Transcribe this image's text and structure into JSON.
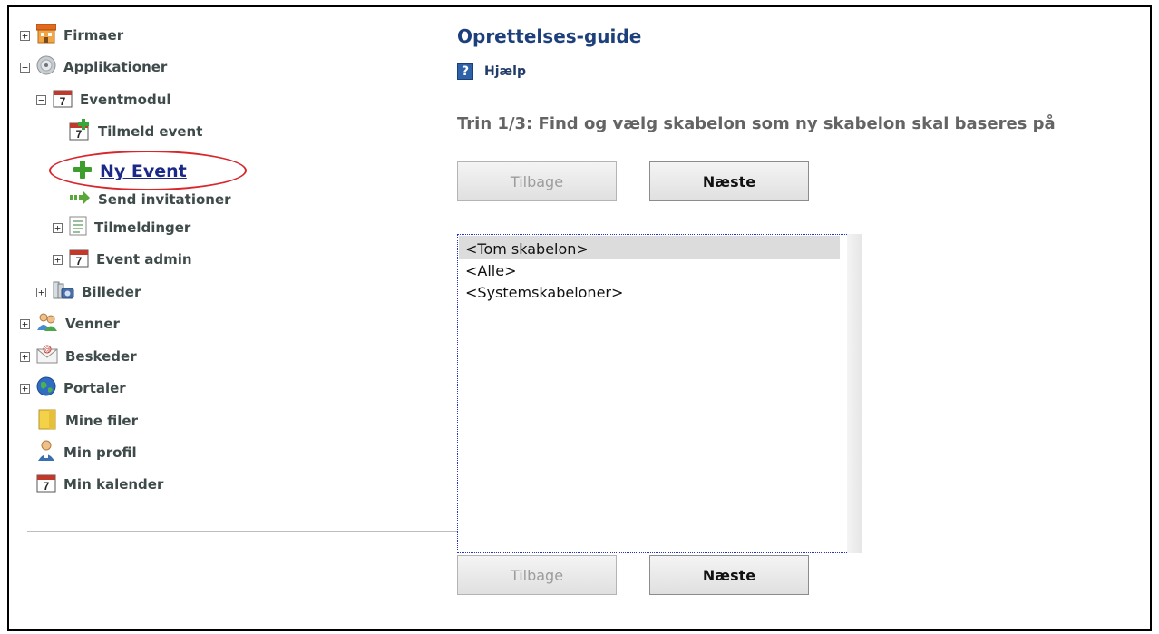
{
  "tree": {
    "firmaer": "Firmaer",
    "applikationer": "Applikationer",
    "eventmodul": "Eventmodul",
    "tilmeld_event": "Tilmeld event",
    "ny_event": "Ny Event",
    "send_invitationer": "Send invitationer",
    "tilmeldinger": "Tilmeldinger",
    "event_admin": "Event admin",
    "billeder": "Billeder",
    "venner": "Venner",
    "beskeder": "Beskeder",
    "portaler": "Portaler",
    "mine_filer": "Mine filer",
    "min_profil": "Min profil",
    "min_kalender": "Min kalender"
  },
  "expanders": {
    "plus": "+",
    "minus": "−"
  },
  "calendar_day": "7",
  "guide": {
    "title": "Oprettelses-guide",
    "help_icon": "?",
    "help_label": "Hjælp",
    "step": "Trin 1/3: Find og vælg skabelon som ny skabelon skal baseres på",
    "back_label": "Tilbage",
    "next_label": "Næste"
  },
  "templates": {
    "items": [
      "<Tom skabelon>",
      "<Alle>",
      "<Systemskabeloner>"
    ],
    "selected_index": 0
  },
  "colors": {
    "title": "#1d3f7c",
    "link": "#1a2a86",
    "highlight_oval": "#d8262c",
    "selection": "#dcdcdc",
    "listbox_border": "#2233cc"
  }
}
